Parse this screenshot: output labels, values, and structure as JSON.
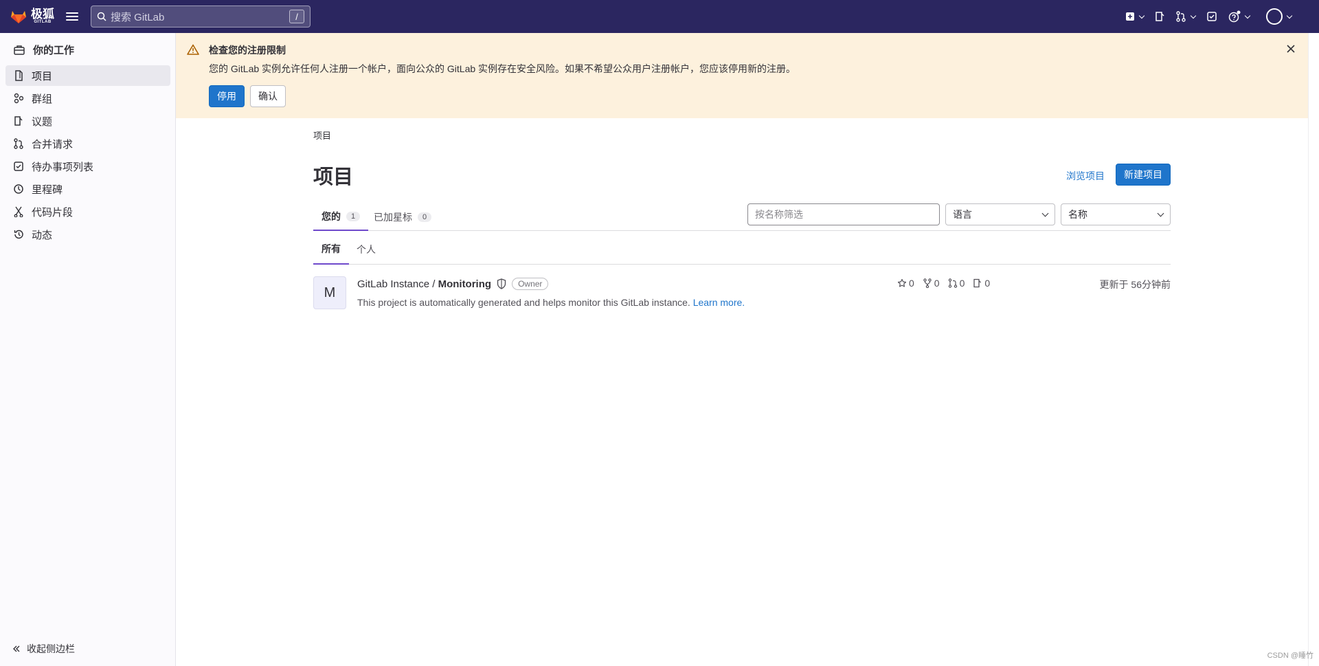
{
  "topbar": {
    "logo_text": "极狐",
    "logo_sub": "GITLAB",
    "search_placeholder": "搜索 GitLab",
    "search_shortcut": "/"
  },
  "sidebar": {
    "header": "你的工作",
    "items": [
      {
        "label": "项目",
        "icon": "project-icon",
        "active": true
      },
      {
        "label": "群组",
        "icon": "group-icon"
      },
      {
        "label": "议题",
        "icon": "issues-icon"
      },
      {
        "label": "合并请求",
        "icon": "merge-request-icon"
      },
      {
        "label": "待办事项列表",
        "icon": "todo-icon"
      },
      {
        "label": "里程碑",
        "icon": "milestone-icon"
      },
      {
        "label": "代码片段",
        "icon": "snippet-icon"
      },
      {
        "label": "动态",
        "icon": "history-icon"
      }
    ],
    "collapse_label": "收起侧边栏"
  },
  "alert": {
    "title": "检查您的注册限制",
    "message": "您的 GitLab 实例允许任何人注册一个帐户，面向公众的 GitLab 实例存在安全风险。如果不希望公众用户注册帐户，您应该停用新的注册。",
    "primary_label": "停用",
    "secondary_label": "确认"
  },
  "main": {
    "breadcrumb": "项目",
    "title": "项目",
    "explore_label": "浏览项目",
    "new_project_label": "新建项目",
    "tabs": [
      {
        "label": "您的",
        "count": "1",
        "active": true
      },
      {
        "label": "已加星标",
        "count": "0"
      }
    ],
    "filter_placeholder": "按名称筛选",
    "language_dropdown": "语言",
    "sort_dropdown": "名称",
    "subtabs": [
      {
        "label": "所有",
        "active": true
      },
      {
        "label": "个人"
      }
    ],
    "projects": [
      {
        "avatar_letter": "M",
        "namespace": "GitLab Instance / ",
        "name": "Monitoring",
        "role": "Owner",
        "description": "This project is automatically generated and helps monitor this GitLab instance. ",
        "learn_more": "Learn more.",
        "stars": "0",
        "forks": "0",
        "merge_requests": "0",
        "issues": "0",
        "updated": "更新于 56分钟前"
      }
    ]
  },
  "watermark": "CSDN @睡竹",
  "colors": {
    "topbar": "#2b2660",
    "alert_bg": "#fdf1dd",
    "primary": "#1f75cb",
    "tab_active": "#6e49cb"
  }
}
